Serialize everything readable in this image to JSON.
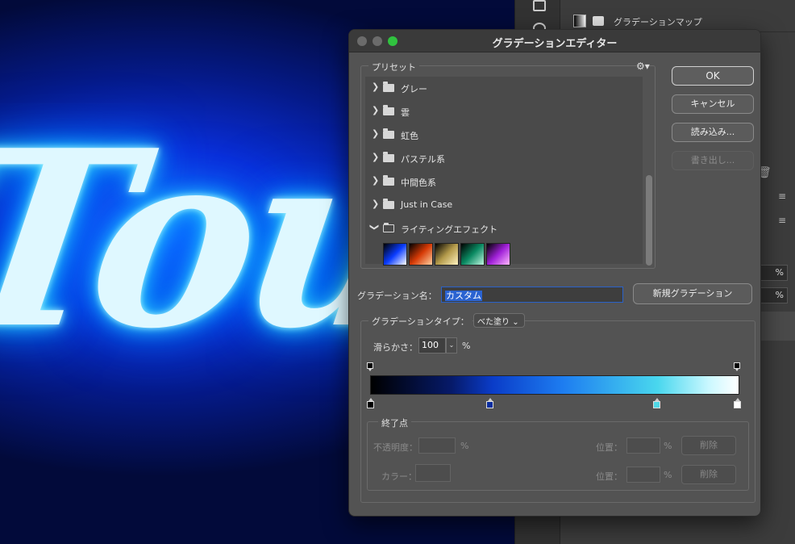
{
  "canvas": {
    "text": "Tou"
  },
  "right_panel": {
    "layer_name": "グラデーションマップ",
    "percent_1": "%",
    "percent_2": "%"
  },
  "dialog": {
    "title": "グラデーションエディター",
    "preset_label": "プリセット",
    "presets": [
      {
        "name": "グレー",
        "expanded": false
      },
      {
        "name": "雲",
        "expanded": false
      },
      {
        "name": "虹色",
        "expanded": false
      },
      {
        "name": "パステル系",
        "expanded": false
      },
      {
        "name": "中間色系",
        "expanded": false
      },
      {
        "name": "Just in Case",
        "expanded": false
      },
      {
        "name": "ライティングエフェクト",
        "expanded": true
      }
    ],
    "preset_swatch_colors": [
      [
        "#000000",
        "#0a3cff",
        "#ffffff"
      ],
      [
        "#000000",
        "#d63a06",
        "#ffd0a0"
      ],
      [
        "#000000",
        "#b39a4a",
        "#fff3c0"
      ],
      [
        "#000000",
        "#0a8a62",
        "#bff7e0"
      ],
      [
        "#000000",
        "#a020d8",
        "#ffb8ff"
      ]
    ],
    "buttons": {
      "ok": "OK",
      "cancel": "キャンセル",
      "load": "読み込み...",
      "save": "書き出し..."
    },
    "name_label": "グラデーション名：",
    "name_value": "カスタム",
    "new_gradient": "新規グラデーション",
    "type_label": "グラデーションタイプ：",
    "type_value": "べた塗り",
    "smoothness_label": "滑らかさ：",
    "smoothness_value": "100",
    "smoothness_unit": "%",
    "gradient_stops": [
      "#000000",
      "#0a2ea0",
      "#4fd8e6",
      "#ffffff"
    ],
    "end_point": {
      "label": "終了点",
      "opacity_label": "不透明度：",
      "opacity_unit": "%",
      "position_label_1": "位置：",
      "position_unit_1": "%",
      "delete_1": "削除",
      "color_label": "カラー：",
      "position_label_2": "位置：",
      "position_unit_2": "%",
      "delete_2": "削除"
    }
  }
}
